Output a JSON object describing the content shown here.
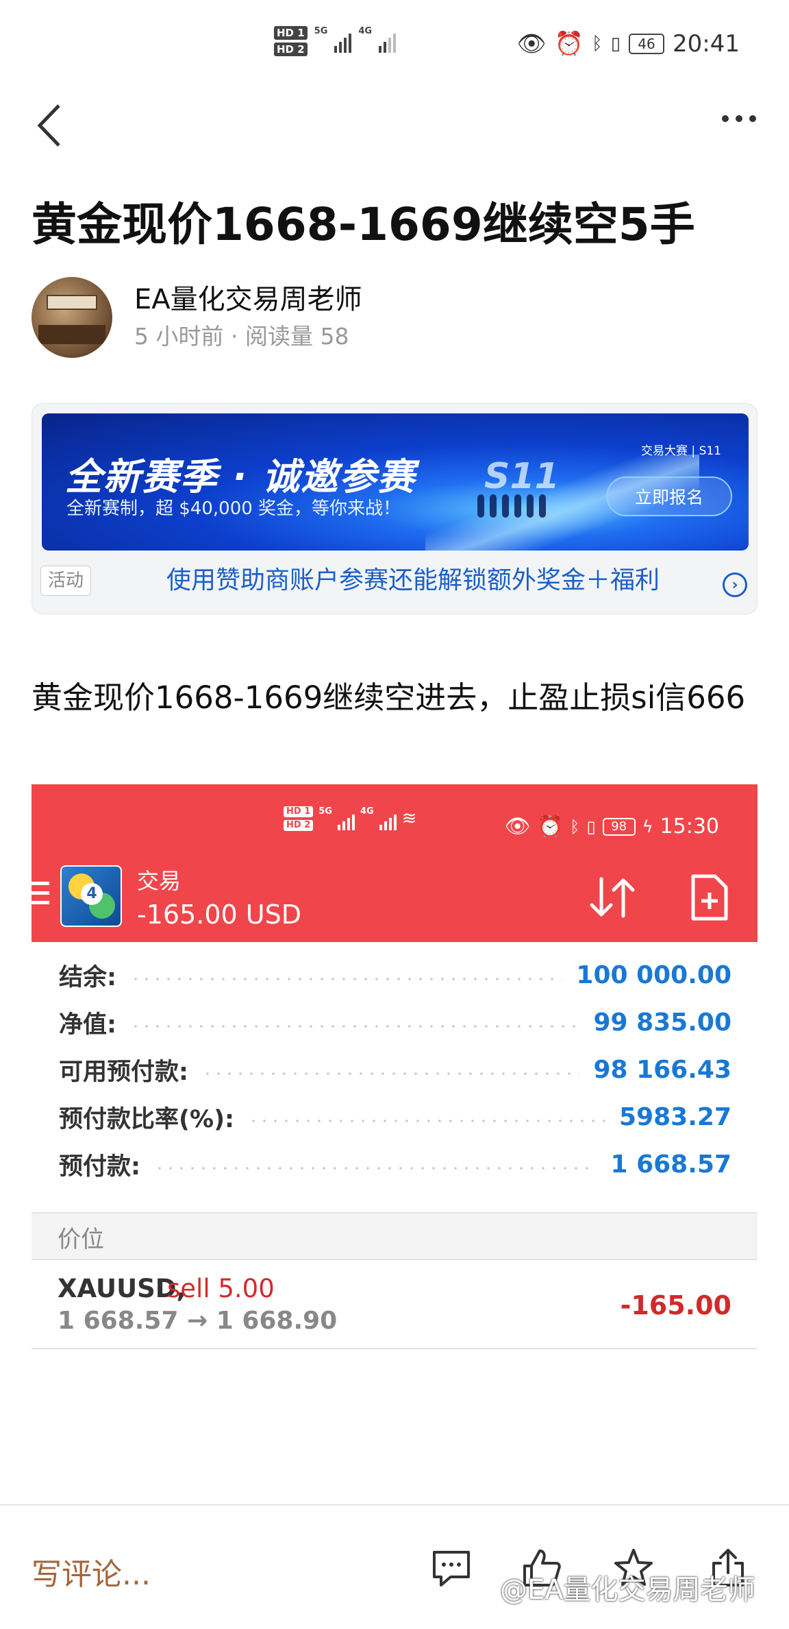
{
  "status_bar": {
    "time": "20:41",
    "battery": "46",
    "sim1": "HD 1",
    "sim2": "HD 2",
    "net1": "5G",
    "net2": "4G"
  },
  "article": {
    "title": "黄金现价1668-1669继续空5手",
    "author_name": "EA量化交易周老师",
    "meta": "5 小时前 · 阅读量 58",
    "body": "黄金现价1668-1669继续空进去，止盈止损si信666"
  },
  "ad": {
    "headline": "全新赛季 · 诚邀参赛",
    "subline": "全新赛制，超 $40,000 奖金，等你来战！",
    "badge": "S11",
    "brand": "交易大赛 | S11",
    "button": "立即报名",
    "tag": "活动",
    "link": "使用赞助商账户参赛还能解锁额外奖金＋福利"
  },
  "screenshot": {
    "status_time": "15:30",
    "status_battery": "98",
    "title": "交易",
    "total": "-165.00 USD",
    "rows": [
      {
        "label": "结余:",
        "value": "100 000.00"
      },
      {
        "label": "净值:",
        "value": "99 835.00"
      },
      {
        "label": "可用预付款:",
        "value": "98 166.43"
      },
      {
        "label": "预付款比率(%):",
        "value": "5983.27"
      },
      {
        "label": "预付款:",
        "value": "1 668.57"
      }
    ],
    "positions_header": "价位",
    "position": {
      "symbol": "XAUUSD,",
      "side": "sell 5.00",
      "prices": "1 668.57 → 1 668.90",
      "pl": "-165.00"
    }
  },
  "bottom_bar": {
    "comment_placeholder": "写评论...",
    "watermark": "@EA量化交易周老师"
  },
  "colors": {
    "accent_red": "#f0464b",
    "value_blue": "#1a78d4",
    "loss_red": "#d12a2a",
    "link_blue": "#1b5fc8"
  }
}
